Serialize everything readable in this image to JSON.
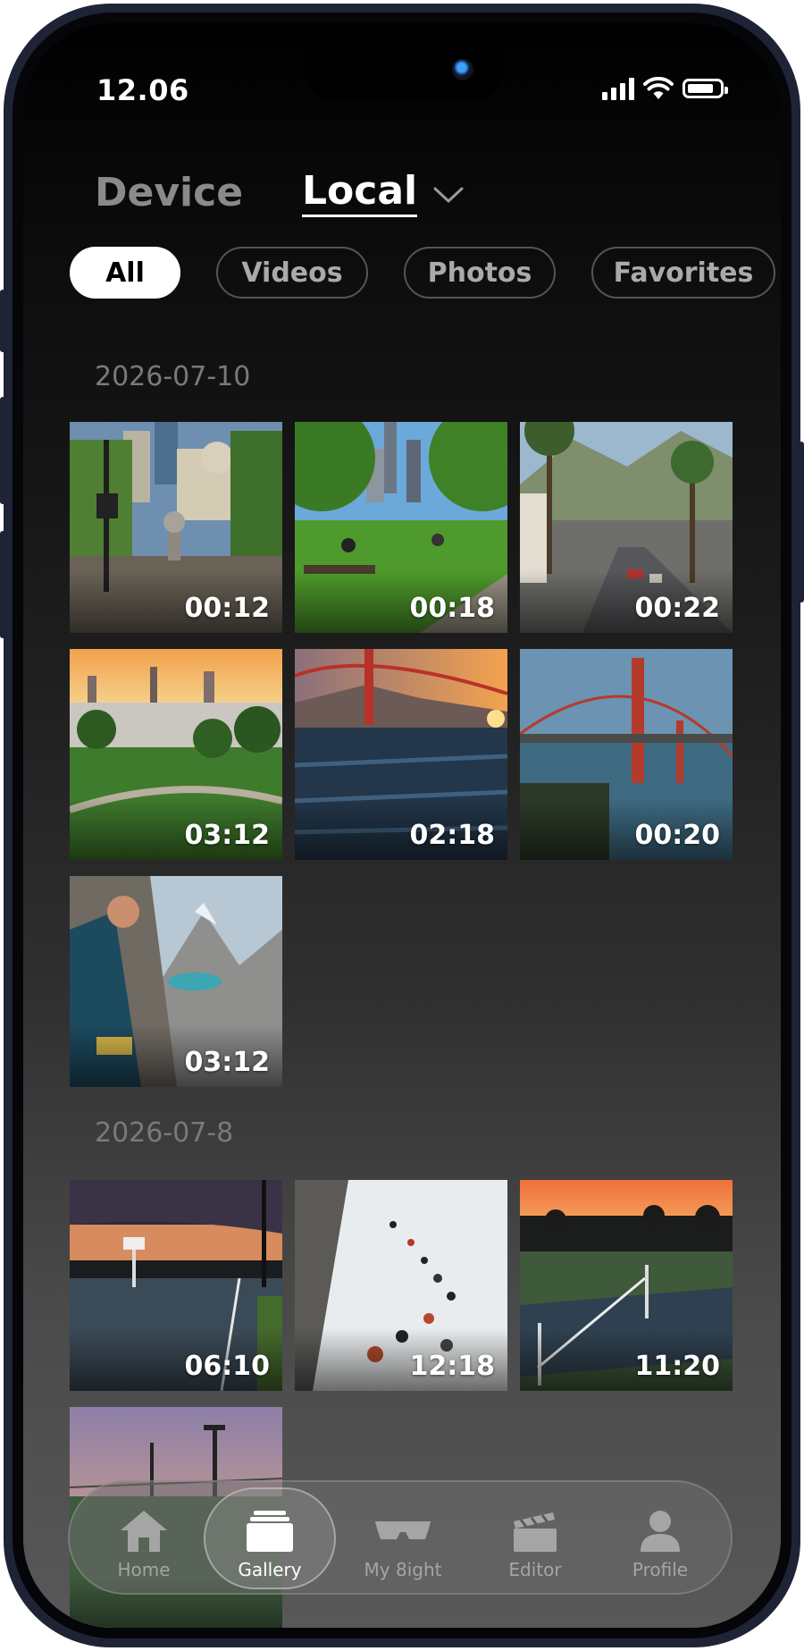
{
  "status_bar": {
    "time": "12.06",
    "icons": [
      "cellular-signal-icon",
      "wifi-icon",
      "battery-icon"
    ]
  },
  "source_tabs": {
    "device_label": "Device",
    "local_label": "Local",
    "selected": "Local",
    "dropdown_icon": "chevron-down-icon"
  },
  "filters": [
    {
      "label": "All",
      "active": true
    },
    {
      "label": "Videos",
      "active": false
    },
    {
      "label": "Photos",
      "active": false
    },
    {
      "label": "Favorites",
      "active": false
    }
  ],
  "sections": [
    {
      "date": "2026-07-10",
      "items": [
        {
          "duration": "00:12",
          "subject": "city hall park"
        },
        {
          "duration": "00:18",
          "subject": "city park lawn"
        },
        {
          "duration": "00:22",
          "subject": "palm street mountains"
        },
        {
          "duration": "03:12",
          "subject": "city skyline sunset park"
        },
        {
          "duration": "02:18",
          "subject": "golden gate bridge sunset"
        },
        {
          "duration": "00:20",
          "subject": "golden gate bridge day"
        },
        {
          "duration": "03:12",
          "subject": "rock climbing mountains"
        }
      ]
    },
    {
      "date": "2026-07-8",
      "items": [
        {
          "duration": "06:10",
          "subject": "basketball court dusk"
        },
        {
          "duration": "12:18",
          "subject": "climbers snowy ridge"
        },
        {
          "duration": "11:20",
          "subject": "tennis court sunset"
        },
        {
          "duration": "",
          "subject": "tennis court evening"
        }
      ]
    }
  ],
  "bottom_nav": [
    {
      "label": "Home",
      "icon": "home-icon",
      "active": false
    },
    {
      "label": "Gallery",
      "icon": "gallery-icon",
      "active": true
    },
    {
      "label": "My 8ight",
      "icon": "glasses-icon",
      "active": false
    },
    {
      "label": "Editor",
      "icon": "clapperboard-icon",
      "active": false
    },
    {
      "label": "Profile",
      "icon": "profile-icon",
      "active": false
    }
  ],
  "colors": {
    "background_top": "#000000",
    "background_bottom": "#585858",
    "active_chip": "#ffffff",
    "inactive_text": "#8a8a8a",
    "date_text": "#7a7a7a"
  }
}
